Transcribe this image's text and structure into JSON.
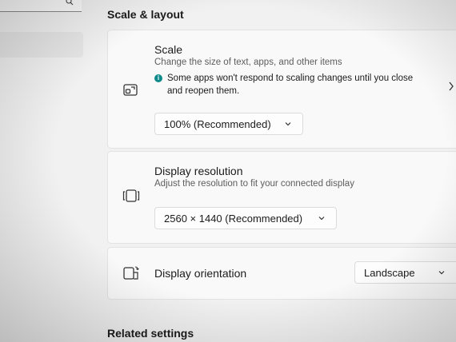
{
  "section_title": "Scale & layout",
  "scale": {
    "title": "Scale",
    "subtitle": "Change the size of text, apps, and other items",
    "info": "Some apps won't respond to scaling changes until you close and reopen them.",
    "dropdown_value": "100% (Recommended)"
  },
  "resolution": {
    "title": "Display resolution",
    "subtitle": "Adjust the resolution to fit your connected display",
    "dropdown_value": "2560 × 1440 (Recommended)"
  },
  "orientation": {
    "title": "Display orientation",
    "dropdown_value": "Landscape"
  },
  "related_title": "Related settings",
  "colors": {
    "accent_info": "#0e8a8a"
  }
}
